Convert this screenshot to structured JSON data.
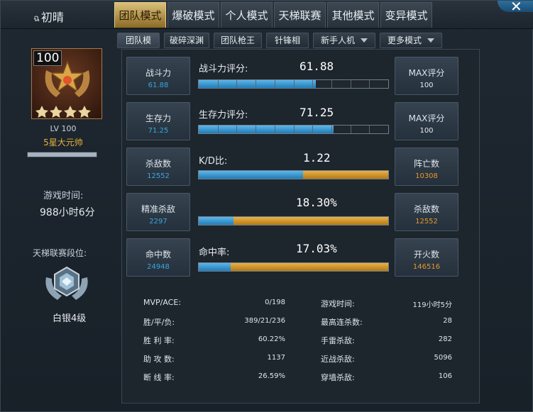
{
  "header": {
    "player_glyph": "ฉ",
    "player_name": "初晴",
    "close_glyph": "✕"
  },
  "tabs": [
    {
      "label": "团队模式",
      "active": true
    },
    {
      "label": "爆破模式",
      "active": false
    },
    {
      "label": "个人模式",
      "active": false
    },
    {
      "label": "天梯联赛",
      "active": false
    },
    {
      "label": "其他模式",
      "active": false
    },
    {
      "label": "变异模式",
      "active": false
    }
  ],
  "subtabs": [
    {
      "label": "团队模式",
      "active": true
    },
    {
      "label": "破碎深渊"
    },
    {
      "label": "团队枪王2"
    },
    {
      "label": "针锋相对"
    },
    {
      "label": "新手人机",
      "dropdown": true
    },
    {
      "label": "更多模式",
      "dropdown": true
    }
  ],
  "profile": {
    "level_badge": "100",
    "level_text": "LV 100",
    "rank_title": "5星大元帅",
    "xp_progress": 1.0,
    "playtime_label": "游戏时间:",
    "playtime_value": "988小时6分",
    "ladder_label": "天梯联赛段位:",
    "ladder_rank": "白银4级"
  },
  "stats": {
    "combat": {
      "left_label": "战斗力",
      "left_value": "61.88",
      "title": "战斗力评分:",
      "value": "61.88",
      "fill": 0.6188,
      "right_label": "MAX评分",
      "right_value": "100"
    },
    "survival": {
      "left_label": "生存力",
      "left_value": "71.25",
      "title": "生存力评分:",
      "value": "71.25",
      "fill": 0.7125,
      "right_label": "MAX评分",
      "right_value": "100"
    },
    "kd": {
      "left_label": "杀敌数",
      "left_value": "12552",
      "title": "K/D比:",
      "value": "1.22",
      "fill": 0.549,
      "right_label": "阵亡数",
      "right_value": "10308"
    },
    "headshot": {
      "left_label": "精准杀敌",
      "left_value": "2297",
      "title": "",
      "value": "18.30%",
      "fill": 0.183,
      "right_label": "杀敌数",
      "right_value": "12552"
    },
    "accuracy": {
      "left_label": "命中数",
      "left_value": "24948",
      "title": "命中率:",
      "value": "17.03%",
      "fill": 0.1703,
      "right_label": "开火数",
      "right_value": "146516"
    }
  },
  "summary": {
    "left": [
      {
        "label": "MVP/ACE:",
        "value": "0/198"
      },
      {
        "label": "胜/平/负:",
        "value": "389/21/236"
      },
      {
        "label": "胜 利 率:",
        "value": "60.22%"
      },
      {
        "label": "助 攻 数:",
        "value": "1137"
      },
      {
        "label": "断 线 率:",
        "value": "26.59%"
      }
    ],
    "right": [
      {
        "label": "游戏时间:",
        "value": "119小时5分"
      },
      {
        "label": "最高连杀数:",
        "value": "28"
      },
      {
        "label": "手雷杀敌:",
        "value": "282"
      },
      {
        "label": "近战杀敌:",
        "value": "5096"
      },
      {
        "label": "穿墙杀敌:",
        "value": "106"
      }
    ]
  },
  "colors": {
    "accent_gold": "#d9c079",
    "bar_blue": "#2f8fd0",
    "bar_orange": "#d4951f",
    "value_blue": "#3aa6e0",
    "value_orange": "#e8962c",
    "rank_gold": "#e6b23a"
  },
  "icons": {
    "avatar": "rank-emblem-icon",
    "ladder": "silver-ladder-badge-icon",
    "close": "close-icon"
  }
}
